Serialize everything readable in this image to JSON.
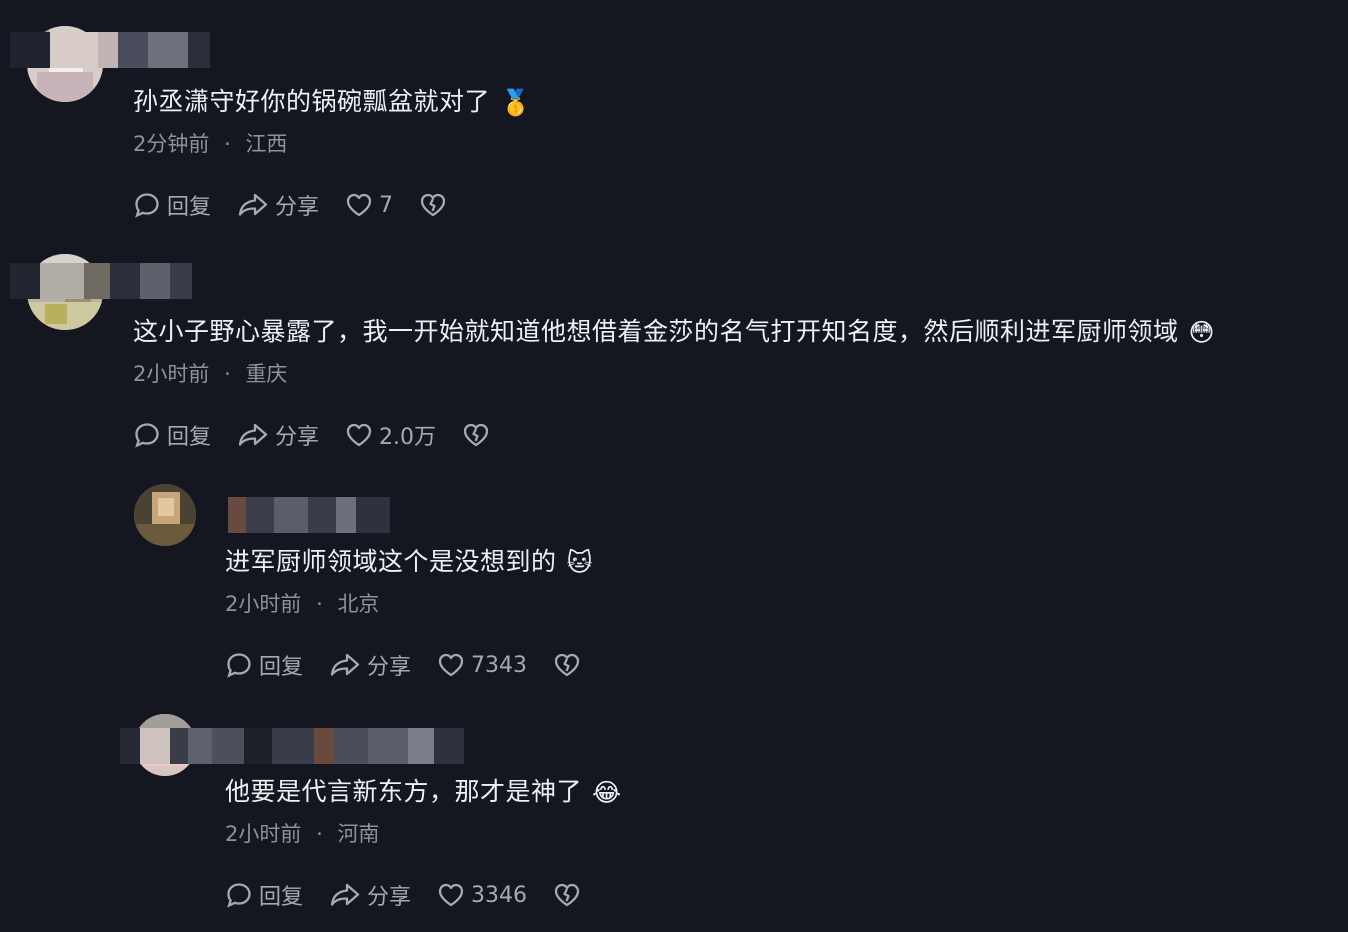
{
  "comments": [
    {
      "text": "孙丞潇守好你的锅碗瓢盆就对了",
      "emoji": "🥇",
      "time": "2分钟前",
      "location": "江西",
      "reply_label": "回复",
      "share_label": "分享",
      "likes": "7"
    },
    {
      "text": "这小子野心暴露了，我一开始就知道他想借着金莎的名气打开知名度，然后顺利进军厨师领域",
      "emoji": "😳",
      "time": "2小时前",
      "location": "重庆",
      "reply_label": "回复",
      "share_label": "分享",
      "likes": "2.0万"
    },
    {
      "text": "进军厨师领域这个是没想到的",
      "emoji": "🐱",
      "time": "2小时前",
      "location": "北京",
      "reply_label": "回复",
      "share_label": "分享",
      "likes": "7343"
    },
    {
      "text": "他要是代言新东方，那才是神了",
      "emoji": "😂",
      "time": "2小时前",
      "location": "河南",
      "reply_label": "回复",
      "share_label": "分享",
      "likes": "3346"
    }
  ],
  "meta_separator": "·",
  "icons": {
    "reply": "speech-bubble-icon",
    "share": "share-arrow-icon",
    "like": "heart-icon",
    "dislike": "broken-heart-icon"
  },
  "colors": {
    "background": "#151720",
    "text": "#eef0f4",
    "meta": "#8d919c",
    "action": "#a6a9b2"
  }
}
